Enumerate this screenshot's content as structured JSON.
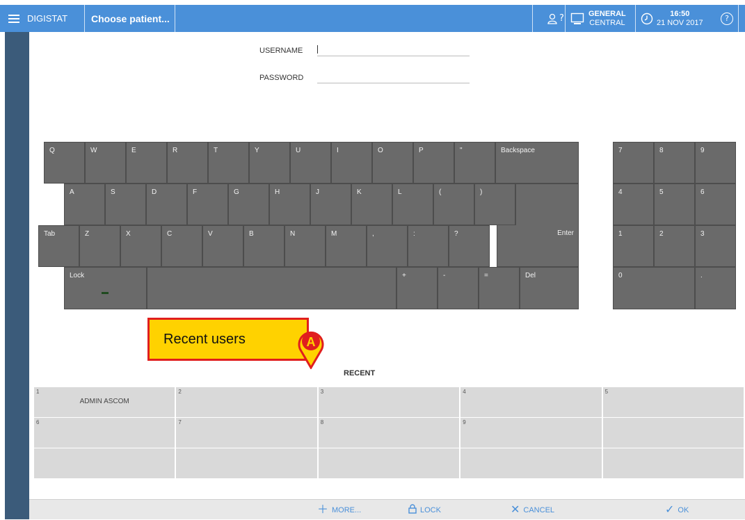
{
  "header": {
    "app_name": "DIGISTAT",
    "title": "Choose patient...",
    "user_status": "?",
    "ward_line1": "GENERAL",
    "ward_line2": "CENTRAL",
    "time": "16:50",
    "date": "21 NOV 2017",
    "help": "?"
  },
  "login": {
    "username_label": "USERNAME",
    "password_label": "PASSWORD",
    "username_value": "",
    "password_value": ""
  },
  "keyboard": {
    "row1": [
      "Q",
      "W",
      "E",
      "R",
      "T",
      "Y",
      "U",
      "I",
      "O",
      "P",
      "\"",
      "Backspace"
    ],
    "row2": [
      "A",
      "S",
      "D",
      "F",
      "G",
      "H",
      "J",
      "K",
      "L",
      "(",
      ")"
    ],
    "row3": [
      "Tab",
      "Z",
      "X",
      "C",
      "V",
      "B",
      "N",
      "M",
      ",",
      ":",
      "?"
    ],
    "enter": "Enter",
    "lock": "Lock",
    "row4_keys": [
      "+",
      "-",
      "=",
      "Del"
    ],
    "numpad": [
      "7",
      "8",
      "9",
      "4",
      "5",
      "6",
      "1",
      "2",
      "3",
      "0",
      "."
    ]
  },
  "callout": {
    "text": "Recent users",
    "marker": "A"
  },
  "recent": {
    "title": "RECENT",
    "cells": [
      {
        "num": "1",
        "name": "ADMIN ASCOM"
      },
      {
        "num": "2",
        "name": ""
      },
      {
        "num": "3",
        "name": ""
      },
      {
        "num": "4",
        "name": ""
      },
      {
        "num": "5",
        "name": ""
      },
      {
        "num": "6",
        "name": ""
      },
      {
        "num": "7",
        "name": ""
      },
      {
        "num": "8",
        "name": ""
      },
      {
        "num": "9",
        "name": ""
      },
      {
        "num": "",
        "name": ""
      },
      {
        "num": "",
        "name": ""
      },
      {
        "num": "",
        "name": ""
      },
      {
        "num": "",
        "name": ""
      },
      {
        "num": "",
        "name": ""
      },
      {
        "num": "",
        "name": ""
      }
    ]
  },
  "footer": {
    "more": "MORE...",
    "lock": "LOCK",
    "cancel": "CANCEL",
    "ok": "OK"
  },
  "colors": {
    "header_bg": "#4a90d9",
    "left_rail": "#3b5b7a",
    "key_bg": "#6a6a6a",
    "recent_cell": "#d9d9d9",
    "callout_fill": "#ffd200",
    "callout_border": "#e01e1e",
    "footer_text": "#4a90d9"
  }
}
